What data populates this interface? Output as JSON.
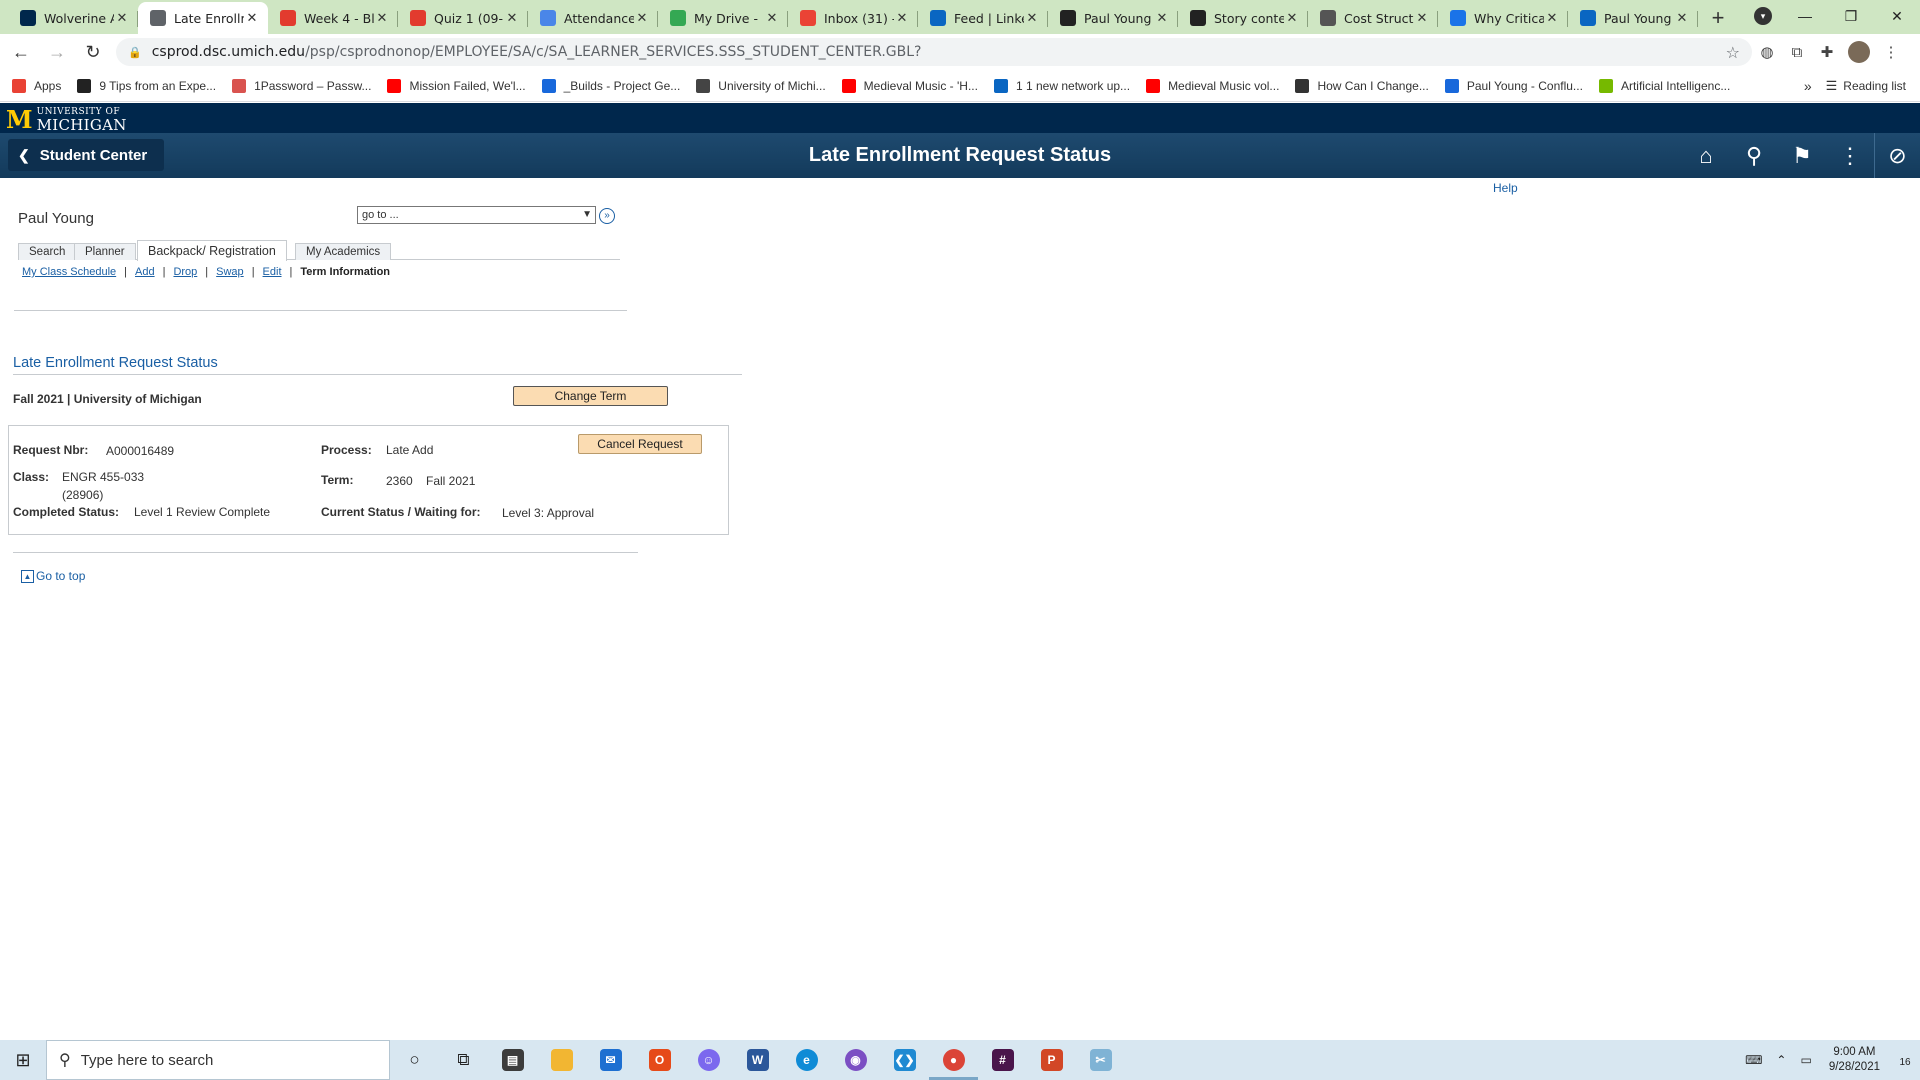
{
  "browser": {
    "tabs": [
      {
        "title": "Wolverine A",
        "icon": "michigan-m-icon",
        "color": "#00274c"
      },
      {
        "title": "Late Enrollm",
        "icon": "globe-icon",
        "color": "#5f6368",
        "active": true
      },
      {
        "title": "Week 4 - Bl",
        "icon": "canvas-icon",
        "color": "#e23b2e"
      },
      {
        "title": "Quiz 1 (09-",
        "icon": "canvas-icon",
        "color": "#e23b2e"
      },
      {
        "title": "Attendance",
        "icon": "google-docs-icon",
        "color": "#4a86e8"
      },
      {
        "title": "My Drive - ",
        "icon": "google-drive-icon",
        "color": "#34a853"
      },
      {
        "title": "Inbox (31) -",
        "icon": "gmail-icon",
        "color": "#ea4335"
      },
      {
        "title": "Feed | Linke",
        "icon": "linkedin-icon",
        "color": "#0a66c2"
      },
      {
        "title": "Paul Young",
        "icon": "yellow-bar-icon",
        "color": "#222222"
      },
      {
        "title": "Story conte",
        "icon": "square-icon",
        "color": "#222222"
      },
      {
        "title": "Cost Structu",
        "icon": "lightbulb-icon",
        "color": "#555555"
      },
      {
        "title": "Why Critica",
        "icon": "blue-doc-icon",
        "color": "#1a73e8"
      },
      {
        "title": "Paul Young",
        "icon": "linkedin-icon",
        "color": "#0a66c2"
      }
    ],
    "url_host": "csprod.dsc.umich.edu",
    "url_path": "/psp/csprodnonop/EMPLOYEE/SA/c/SA_LEARNER_SERVICES.SSS_STUDENT_CENTER.GBL?",
    "bookmarks": [
      {
        "label": "Apps",
        "icon": "apps-grid-icon",
        "color": "#e94235"
      },
      {
        "label": "9 Tips from an Expe...",
        "icon": "bookmark-site-icon",
        "color": "#222222"
      },
      {
        "label": "1Password – Passw...",
        "icon": "rainbow-icon",
        "color": "#d9534f"
      },
      {
        "label": "Mission Failed, We'l...",
        "icon": "youtube-icon",
        "color": "#ff0000"
      },
      {
        "label": "_Builds - Project Ge...",
        "icon": "confluence-icon",
        "color": "#1868db"
      },
      {
        "label": "University of Michi...",
        "icon": "cube-icon",
        "color": "#444444"
      },
      {
        "label": "Medieval Music - 'H...",
        "icon": "youtube-icon",
        "color": "#ff0000"
      },
      {
        "label": "1 1 new network up...",
        "icon": "linkedin-icon",
        "color": "#0a66c2"
      },
      {
        "label": "Medieval Music vol...",
        "icon": "youtube-icon",
        "color": "#ff0000"
      },
      {
        "label": "How Can I Change...",
        "icon": "w-icon",
        "color": "#333333"
      },
      {
        "label": "Paul Young - Conflu...",
        "icon": "confluence-icon",
        "color": "#1868db"
      },
      {
        "label": "Artificial Intelligenc...",
        "icon": "nvidia-icon",
        "color": "#76b900"
      }
    ],
    "reading_list": "Reading list"
  },
  "ps": {
    "brand_line1": "UNIVERSITY OF",
    "brand_line2": "MICHIGAN",
    "back_label": "Student Center",
    "page_title": "Late Enrollment Request Status",
    "help": "Help",
    "user_name": "Paul Young",
    "goto_value": "go to ...",
    "tabs": [
      "Search",
      "Planner",
      "Backpack/ Registration",
      "My Academics"
    ],
    "subnav": [
      "My Class Schedule",
      "Add",
      "Drop",
      "Swap",
      "Edit",
      "Term Information"
    ],
    "section_title": "Late Enrollment Request Status",
    "term_line": "Fall 2021 | University of Michigan",
    "change_term": "Change Term",
    "cancel_request": "Cancel Request",
    "request": {
      "request_nbr_label": "Request Nbr:",
      "request_nbr": "A000016489",
      "process_label": "Process:",
      "process": "Late Add",
      "class_label": "Class:",
      "class_value": "ENGR 455-033",
      "class_nbr": "(28906)",
      "term_label": "Term:",
      "term_code": "2360",
      "term_name": "Fall 2021",
      "completed_label": "Completed Status:",
      "completed": "Level 1 Review Complete",
      "current_label": "Current Status / Waiting for:",
      "current": "Level 3: Approval"
    },
    "go_to_top": "Go to top"
  },
  "taskbar": {
    "search_placeholder": "Type here to search",
    "time": "9:00 AM",
    "date": "9/28/2021",
    "notification_count": "16"
  }
}
